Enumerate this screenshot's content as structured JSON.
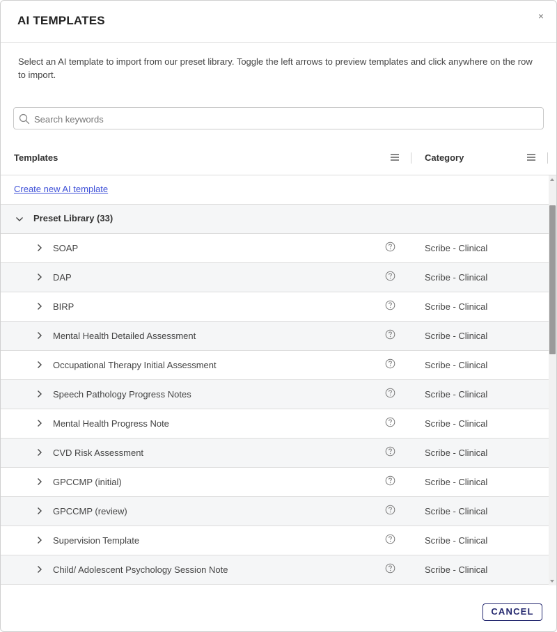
{
  "dialog": {
    "title": "AI TEMPLATES",
    "close_glyph": "×",
    "description": "Select an AI template to import from our preset library. Toggle the left arrows to preview templates and click anywhere on the row to import."
  },
  "search": {
    "placeholder": "Search keywords",
    "value": ""
  },
  "table": {
    "columns": [
      {
        "label": "Templates"
      },
      {
        "label": "Category"
      }
    ],
    "create_link": "Create new AI template",
    "group": {
      "label": "Preset Library (33)",
      "expanded": true
    },
    "rows": [
      {
        "name": "SOAP",
        "category": "Scribe - Clinical"
      },
      {
        "name": "DAP",
        "category": "Scribe - Clinical"
      },
      {
        "name": "BIRP",
        "category": "Scribe - Clinical"
      },
      {
        "name": "Mental Health Detailed Assessment",
        "category": "Scribe - Clinical"
      },
      {
        "name": "Occupational Therapy Initial Assessment",
        "category": "Scribe - Clinical"
      },
      {
        "name": "Speech Pathology Progress Notes",
        "category": "Scribe - Clinical"
      },
      {
        "name": "Mental Health Progress Note",
        "category": "Scribe - Clinical"
      },
      {
        "name": "CVD Risk Assessment",
        "category": "Scribe - Clinical"
      },
      {
        "name": "GPCCMP (initial)",
        "category": "Scribe - Clinical"
      },
      {
        "name": "GPCCMP (review)",
        "category": "Scribe - Clinical"
      },
      {
        "name": "Supervision Template",
        "category": "Scribe - Clinical"
      },
      {
        "name": "Child/ Adolescent Psychology Session Note",
        "category": "Scribe - Clinical"
      }
    ]
  },
  "footer": {
    "cancel_label": "CANCEL"
  },
  "colors": {
    "link": "#3f51d8",
    "accent": "#23276e",
    "row_alt": "#f5f6f7",
    "scroll_thumb": "#9a9a9a"
  },
  "icons": {
    "search": "search-icon",
    "close": "close-icon",
    "column_menu": "column-menu-icon",
    "group_toggle": "chevron-down-icon",
    "row_toggle": "chevron-right-icon",
    "help": "help-circle-icon"
  }
}
